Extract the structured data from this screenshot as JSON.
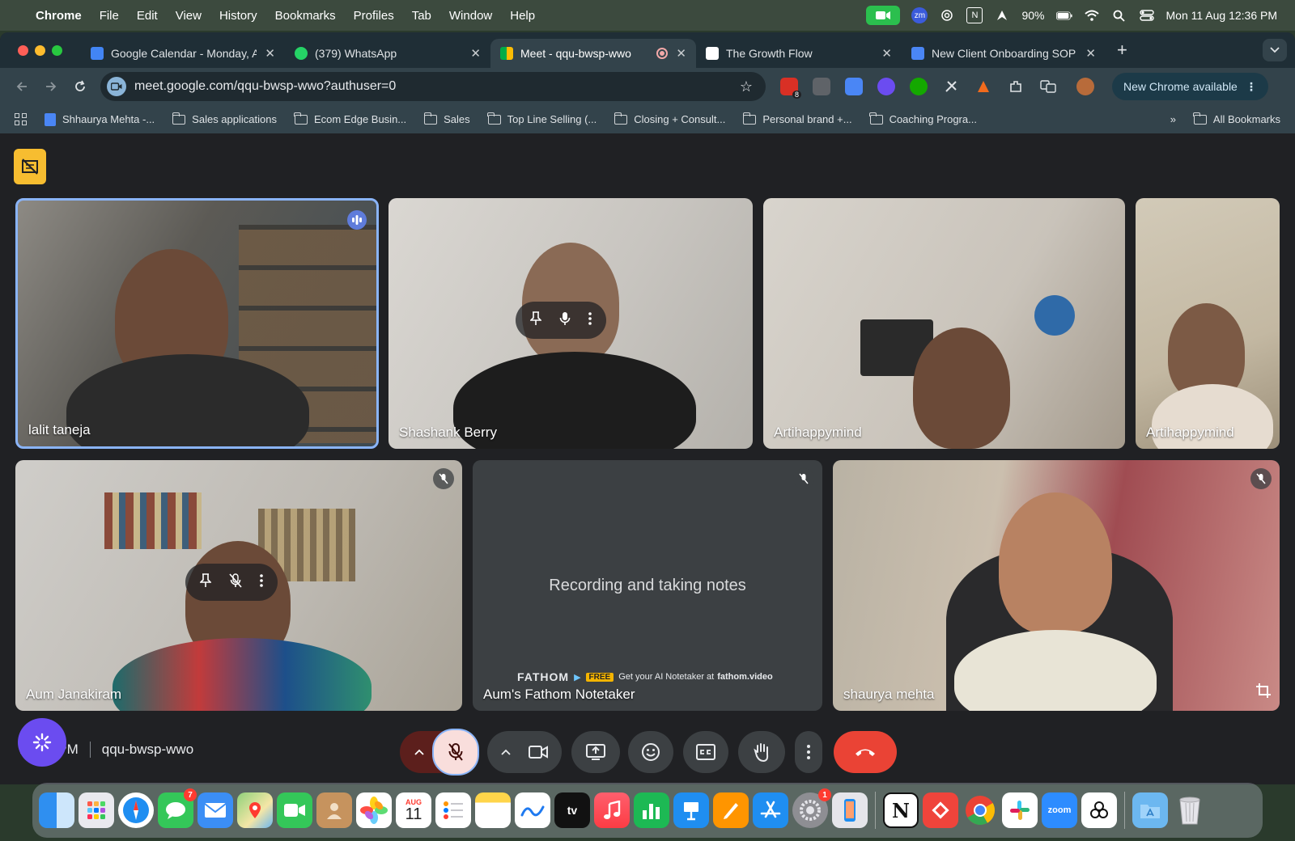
{
  "menubar": {
    "app": "Chrome",
    "items": [
      "File",
      "Edit",
      "View",
      "History",
      "Bookmarks",
      "Profiles",
      "Tab",
      "Window",
      "Help"
    ],
    "battery": "90%",
    "datetime": "Mon 11 Aug  12:36 PM",
    "zm_label": "zm",
    "n_label": "N"
  },
  "tabs": [
    {
      "title": "Google Calendar - Monday, A",
      "close": "✕"
    },
    {
      "title": "(379) WhatsApp",
      "close": "✕"
    },
    {
      "title": "Meet - qqu-bwsp-wwo",
      "close": "✕"
    },
    {
      "title": "The Growth Flow",
      "close": "✕"
    },
    {
      "title": "New Client Onboarding SOP -",
      "close": "✕"
    }
  ],
  "newtab_label": "+",
  "toolbar": {
    "url": "meet.google.com/qqu-bwsp-wwo?authuser=0",
    "new_chrome": "New Chrome available",
    "ext_badge": "8"
  },
  "bookmarks": [
    "Shhaurya Mehta -...",
    "Sales applications",
    "Ecom Edge Busin...",
    "Sales",
    "Top Line Selling (...",
    "Closing + Consult...",
    "Personal brand +...",
    "Coaching Progra..."
  ],
  "bookmarks_more": "»",
  "all_bookmarks": "All Bookmarks",
  "participants": {
    "p1": "lalit taneja",
    "p2": "Shashank Berry",
    "p3": "Artihappymind",
    "p4": "Artihappymind",
    "p5": "Aum Janakiram",
    "p6": "Aum's Fathom Notetaker",
    "p7": "shaurya mehta"
  },
  "fathom": {
    "message": "Recording and taking notes",
    "brand": "FATHOM",
    "free": "FREE",
    "promo": "Get your AI Notetaker at",
    "site": "fathom.video"
  },
  "meeting": {
    "time": "12:36 PM",
    "code": "qqu-bwsp-wwo"
  },
  "dock": {
    "calendar_month": "AUG",
    "calendar_day": "11",
    "messages_badge": "7",
    "settings_badge": "1",
    "appletv_label": "tv",
    "zoom_label": "zoom",
    "notion_label": "N"
  },
  "colors": {
    "meet_bg": "#202124",
    "end_call": "#ea4335",
    "mic_off": "#f9dedc",
    "active_speaker": "#8ab4f8"
  }
}
